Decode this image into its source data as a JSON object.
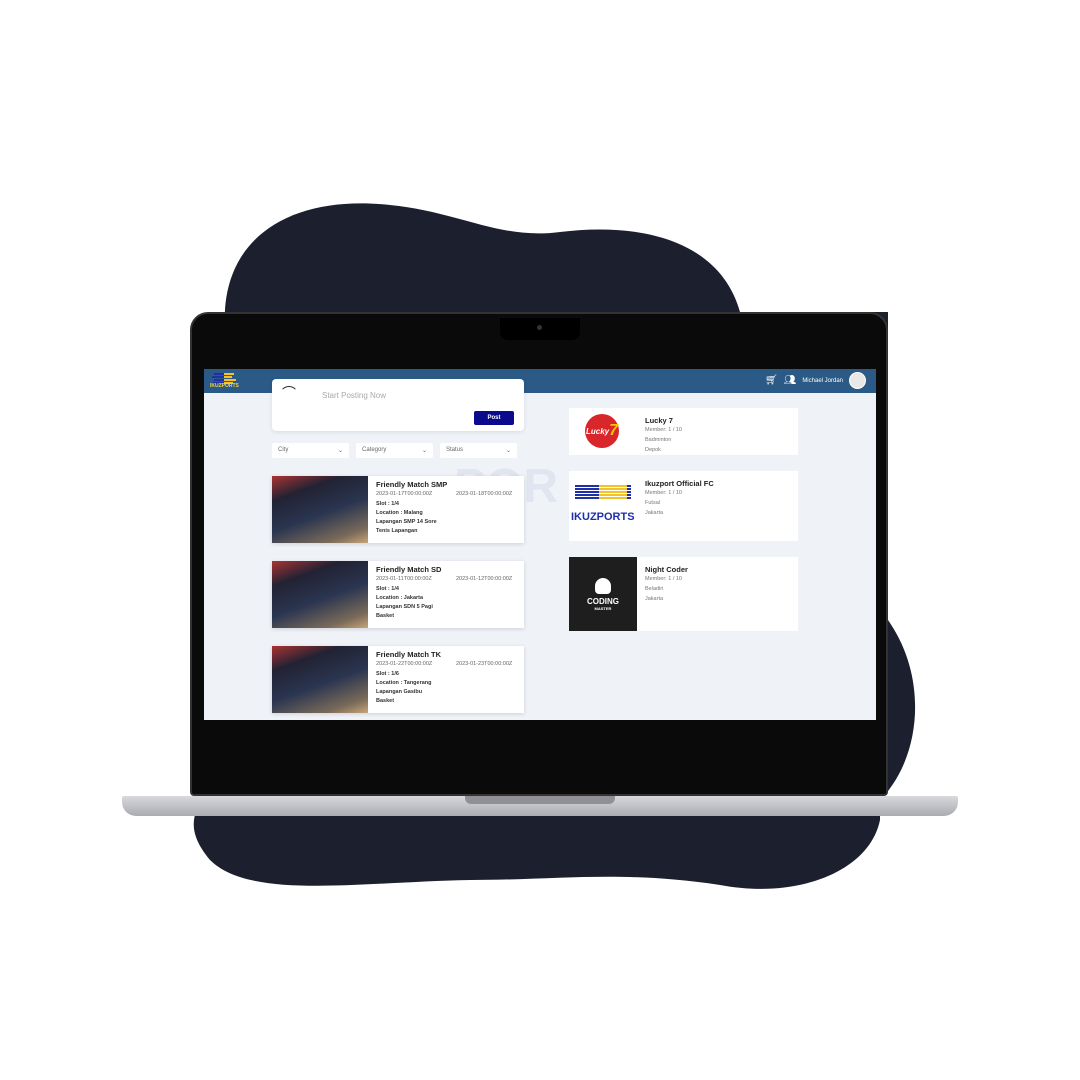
{
  "app": {
    "logo_text": "IKUZPORTS",
    "user_name": "Michael Jordan",
    "cart_icon": "cart-icon",
    "friends_icon": "users-icon"
  },
  "post": {
    "placeholder": "Start Posting Now",
    "button": "Post"
  },
  "filters": [
    "City",
    "Category",
    "Status"
  ],
  "watermark": "POR",
  "matches": [
    {
      "title": "Friendly Match SMP",
      "start": "2023-01-17T00:00:00Z",
      "end": "2023-01-18T00:00:00Z",
      "slot": "Slot : 1/4",
      "location": "Location : Malang",
      "venue": "Lapangan SMP 14 Sore",
      "sport": "Tenis Lapangan"
    },
    {
      "title": "Friendly Match SD",
      "start": "2023-01-11T00:00:00Z",
      "end": "2023-01-12T00:00:00Z",
      "slot": "Slot : 1/4",
      "location": "Location : Jakarta",
      "venue": "Lapangan SDN 5 Pagi",
      "sport": "Basket"
    },
    {
      "title": "Friendly Match TK",
      "start": "2023-01-22T00:00:00Z",
      "end": "2023-01-23T00:00:00Z",
      "slot": "Slot : 1/6",
      "location": "Location : Tangerang",
      "venue": "Lapangan Gasibu",
      "sport": "Basket"
    }
  ],
  "clubs": [
    {
      "name": "Lucky 7",
      "member": "Member: 1 / 10",
      "sport": "Badminton",
      "city": "Depok",
      "logo": "Lucky 7"
    },
    {
      "name": "Ikuzport Official FC",
      "member": "Member: 1 / 10",
      "sport": "Futsal",
      "city": "Jakarta",
      "logo": "IKUZPORTS"
    },
    {
      "name": "Night Coder",
      "member": "Member: 1 / 10",
      "sport": "Beladiri",
      "city": "Jakarta",
      "logo": "CODING MASTER"
    }
  ]
}
